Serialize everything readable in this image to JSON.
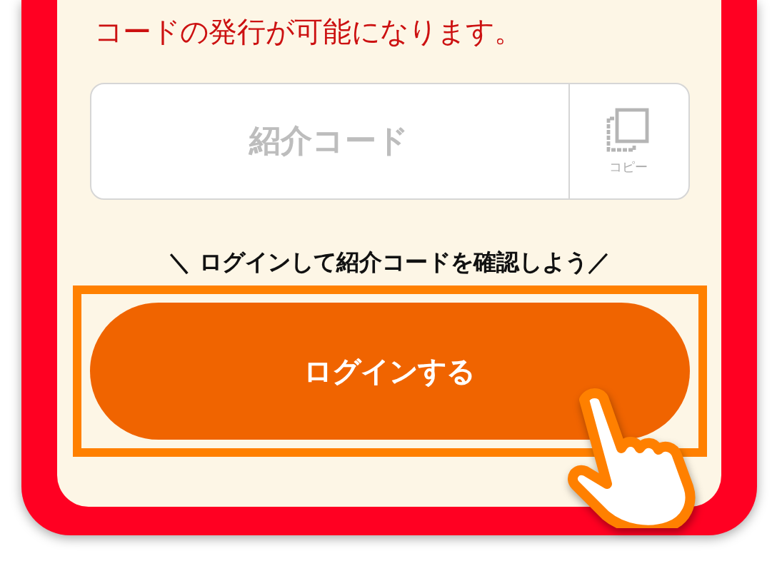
{
  "notice": "コードの発行が可能になります。",
  "code_field": {
    "placeholder": "紹介コード",
    "copy_label": "コピー"
  },
  "prompt": "＼ ログインして紹介コードを確認しよう／",
  "login_button": {
    "label": "ログインする",
    "highlighted": true
  }
}
